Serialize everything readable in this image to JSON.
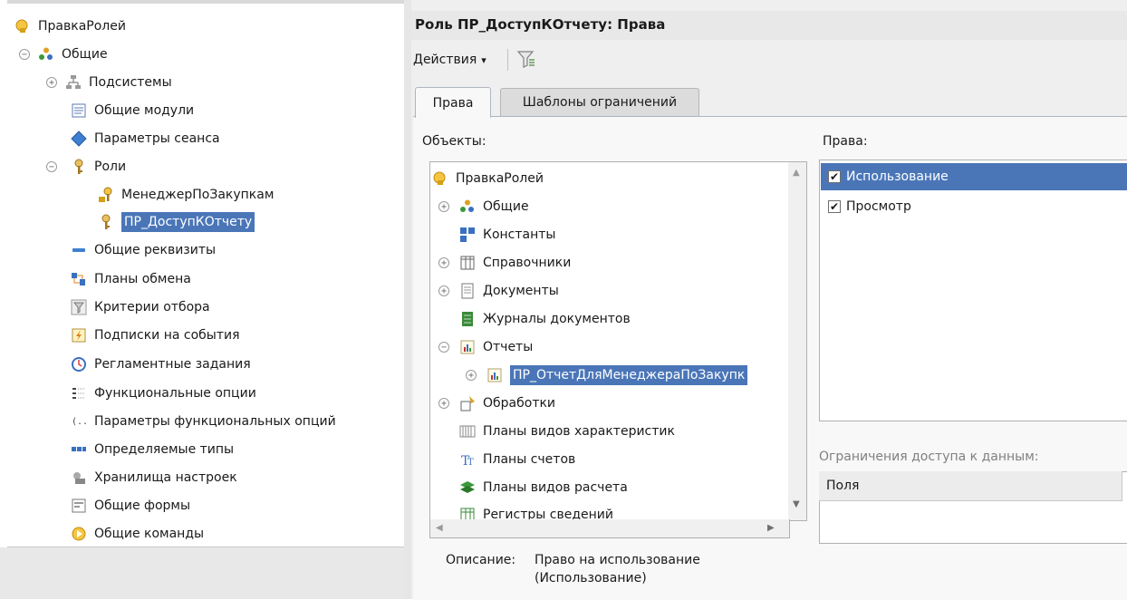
{
  "left_tree": {
    "items": [
      {
        "label": "ПравкаРолей",
        "icon": "config-key-icon",
        "expander": ""
      },
      {
        "label": "Общие",
        "icon": "common-group-icon",
        "expander": "−"
      },
      {
        "label": "Подсистемы",
        "icon": "subsystems-icon",
        "expander": "+"
      },
      {
        "label": "Общие модули",
        "icon": "module-icon",
        "expander": ""
      },
      {
        "label": "Параметры сеанса",
        "icon": "session-param-icon",
        "expander": ""
      },
      {
        "label": "Роли",
        "icon": "key-icon",
        "expander": "−"
      },
      {
        "label": "МенеджерПоЗакупкам",
        "icon": "role-key-icon",
        "expander": ""
      },
      {
        "label": "ПР_ДоступКОтчету",
        "icon": "key-icon",
        "expander": ""
      },
      {
        "label": "Общие реквизиты",
        "icon": "attribute-icon",
        "expander": ""
      },
      {
        "label": "Планы обмена",
        "icon": "exchange-plan-icon",
        "expander": ""
      },
      {
        "label": "Критерии отбора",
        "icon": "filter-criteria-icon",
        "expander": ""
      },
      {
        "label": "Подписки на события",
        "icon": "event-subscription-icon",
        "expander": ""
      },
      {
        "label": "Регламентные задания",
        "icon": "scheduled-job-icon",
        "expander": ""
      },
      {
        "label": "Функциональные опции",
        "icon": "functional-option-icon",
        "expander": ""
      },
      {
        "label": "Параметры функциональных опций",
        "icon": "functional-param-icon",
        "expander": ""
      },
      {
        "label": "Определяемые типы",
        "icon": "defined-type-icon",
        "expander": ""
      },
      {
        "label": "Хранилища настроек",
        "icon": "settings-storage-icon",
        "expander": ""
      },
      {
        "label": "Общие формы",
        "icon": "form-icon",
        "expander": ""
      },
      {
        "label": "Общие команды",
        "icon": "command-icon",
        "expander": ""
      }
    ],
    "selected_index": 7
  },
  "window": {
    "title": "Роль ПР_ДоступКОтчету: Права",
    "actions_label": "Действия",
    "actions_arrow": "▾",
    "tabs": [
      {
        "label": "Права",
        "active": true
      },
      {
        "label": "Шаблоны ограничений",
        "active": false
      }
    ],
    "objects_label": "Объекты:",
    "rights_label": "Права:",
    "restrictions_label": "Ограничения доступа к данным:",
    "restrictions_column": "Поля",
    "description_label": "Описание:",
    "description_line1": "Право на использование",
    "description_line2": "(Использование)"
  },
  "objects_tree": {
    "items": [
      {
        "label": "ПравкаРолей",
        "icon": "config-key-icon",
        "expander": ""
      },
      {
        "label": "Общие",
        "icon": "common-group-icon",
        "expander": "+"
      },
      {
        "label": "Константы",
        "icon": "constants-icon",
        "expander": ""
      },
      {
        "label": "Справочники",
        "icon": "catalog-icon",
        "expander": "+"
      },
      {
        "label": "Документы",
        "icon": "document-icon",
        "expander": "+"
      },
      {
        "label": "Журналы документов",
        "icon": "journal-icon",
        "expander": ""
      },
      {
        "label": "Отчеты",
        "icon": "report-icon",
        "expander": "−"
      },
      {
        "label": "ПР_ОтчетДляМенеджераПоЗакупк",
        "icon": "report-icon",
        "expander": "+"
      },
      {
        "label": "Обработки",
        "icon": "data-processor-icon",
        "expander": "+"
      },
      {
        "label": "Планы видов характеристик",
        "icon": "chart-of-characteristics-icon",
        "expander": ""
      },
      {
        "label": "Планы счетов",
        "icon": "chart-of-accounts-icon",
        "expander": ""
      },
      {
        "label": "Планы видов расчета",
        "icon": "chart-of-calculation-icon",
        "expander": ""
      },
      {
        "label": "Регистры сведений",
        "icon": "info-register-icon",
        "expander": ""
      }
    ],
    "selected_index": 7
  },
  "rights": {
    "items": [
      {
        "label": "Использование",
        "checked": true,
        "selected": true
      },
      {
        "label": "Просмотр",
        "checked": true,
        "selected": false
      }
    ]
  },
  "colors": {
    "selection": "#4a76b8"
  }
}
